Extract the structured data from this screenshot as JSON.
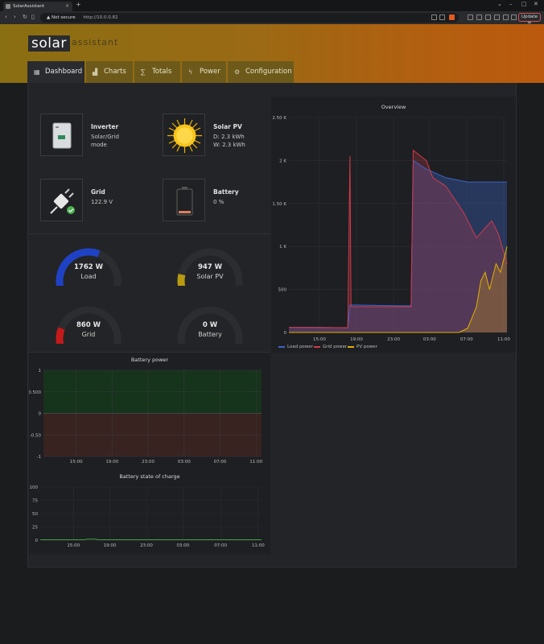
{
  "browser": {
    "tab_title": "SolarAssistant",
    "not_secure": "Not secure",
    "url": "http://10.0.0.82",
    "update_label": "Update"
  },
  "brand": {
    "solar": "solar",
    "assistant": "assistant"
  },
  "nav": {
    "tabs": [
      {
        "label": "Dashboard",
        "icon": "dashboard-icon",
        "active": true
      },
      {
        "label": "Charts",
        "icon": "chart-icon"
      },
      {
        "label": "Totals",
        "icon": "sigma-icon"
      },
      {
        "label": "Power",
        "icon": "bolt-icon"
      },
      {
        "label": "Configuration",
        "icon": "gear-icon"
      }
    ]
  },
  "cards": {
    "inverter": {
      "title": "Inverter",
      "line1": "Solar/Grid",
      "line2": "mode"
    },
    "solar": {
      "title": "Solar PV",
      "line1": "D: 2.3 kWh",
      "line2": "W: 2.3 kWh"
    },
    "grid": {
      "title": "Grid",
      "line1": "122.9 V"
    },
    "battery": {
      "title": "Battery",
      "line1": "0 %"
    }
  },
  "gauges": [
    {
      "value": "1762 W",
      "label": "Load",
      "fraction": 0.6,
      "color": "#1f42c4"
    },
    {
      "value": "947 W",
      "label": "Solar PV",
      "fraction": 0.13,
      "color": "#b89a10"
    },
    {
      "value": "860 W",
      "label": "Grid",
      "fraction": 0.17,
      "color": "#c41a1a"
    },
    {
      "value": "0 W",
      "label": "Battery",
      "fraction": 0.0,
      "color": "#555555"
    }
  ],
  "chart_data": [
    {
      "type": "line",
      "title": "Overview",
      "y_ticks": [
        "2.50 K",
        "2 K",
        "1.50 K",
        "1 K",
        "500",
        "0"
      ],
      "x_ticks": [
        "15:00",
        "19:00",
        "23:00",
        "03:00",
        "07:00",
        "11:00"
      ],
      "ylim": [
        0,
        2500
      ],
      "series": [
        {
          "name": "Load power",
          "color": "#3b64c8",
          "values": [
            [
              0,
              60
            ],
            [
              0.12,
              60
            ],
            [
              0.27,
              55
            ],
            [
              0.28,
              320
            ],
            [
              0.5,
              310
            ],
            [
              0.56,
              310
            ],
            [
              0.57,
              2000
            ],
            [
              0.63,
              1900
            ],
            [
              0.72,
              1800
            ],
            [
              0.82,
              1750
            ],
            [
              1,
              1750
            ]
          ]
        },
        {
          "name": "Grid power",
          "color": "#d23a4a",
          "values": [
            [
              0,
              60
            ],
            [
              0.27,
              55
            ],
            [
              0.28,
              2050
            ],
            [
              0.285,
              300
            ],
            [
              0.5,
              300
            ],
            [
              0.56,
              300
            ],
            [
              0.57,
              2120
            ],
            [
              0.63,
              2000
            ],
            [
              0.66,
              1800
            ],
            [
              0.72,
              1700
            ],
            [
              0.8,
              1400
            ],
            [
              0.86,
              1100
            ],
            [
              0.93,
              1300
            ],
            [
              0.96,
              1150
            ],
            [
              1,
              800
            ]
          ]
        },
        {
          "name": "PV power",
          "color": "#e0b000",
          "values": [
            [
              0,
              0
            ],
            [
              0.78,
              0
            ],
            [
              0.82,
              50
            ],
            [
              0.86,
              300
            ],
            [
              0.88,
              600
            ],
            [
              0.9,
              700
            ],
            [
              0.92,
              500
            ],
            [
              0.95,
              800
            ],
            [
              0.97,
              700
            ],
            [
              1,
              1000
            ]
          ]
        }
      ]
    },
    {
      "type": "area",
      "title": "Battery power",
      "y_ticks": [
        "1",
        "0.500",
        "0",
        "-0.50",
        "-1"
      ],
      "x_ticks": [
        "15:00",
        "19:00",
        "23:00",
        "03:00",
        "07:00",
        "11:00"
      ],
      "ylim": [
        -1,
        1
      ],
      "series": [
        {
          "values": [
            [
              0,
              0
            ],
            [
              1,
              0
            ]
          ]
        }
      ]
    },
    {
      "type": "line",
      "title": "Battery state of charge",
      "y_ticks": [
        "100",
        "75",
        "50",
        "25",
        "0"
      ],
      "x_ticks": [
        "15:00",
        "19:00",
        "23:00",
        "03:00",
        "07:00",
        "11:00"
      ],
      "ylim": [
        0,
        100
      ],
      "series": [
        {
          "color": "#3fa53f",
          "values": [
            [
              0,
              0
            ],
            [
              0.2,
              0
            ],
            [
              0.21,
              1
            ],
            [
              0.25,
              1
            ],
            [
              0.26,
              0
            ],
            [
              1,
              0
            ]
          ]
        }
      ]
    }
  ]
}
